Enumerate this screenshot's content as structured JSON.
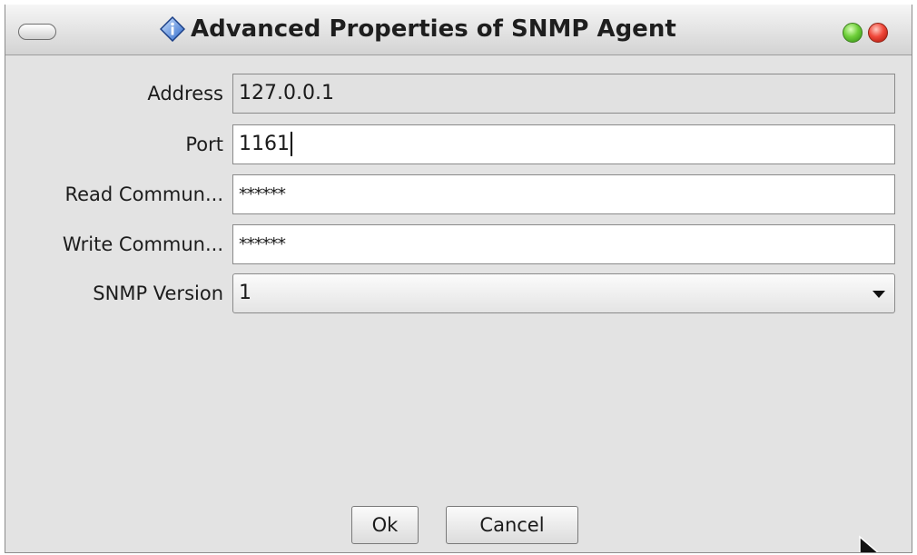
{
  "window": {
    "title": "Advanced Properties of SNMP Agent",
    "title_icon": "info-diamond-icon",
    "buttons": [
      "maximize-green-button",
      "close-red-button"
    ]
  },
  "form": {
    "address": {
      "label": "Address",
      "value": "127.0.0.1",
      "editable": false
    },
    "port": {
      "label": "Port",
      "value": "1161",
      "focused": true
    },
    "read_community": {
      "label": "Read Commun...",
      "value": "******"
    },
    "write_community": {
      "label": "Write Commun...",
      "value": "******"
    },
    "snmp_version": {
      "label": "SNMP Version",
      "value": "1"
    }
  },
  "buttons": {
    "ok": "Ok",
    "cancel": "Cancel"
  },
  "colors": {
    "window_bg": "#e3e3e3",
    "field_bg": "#ffffff",
    "readonly_bg": "#e1e1e1",
    "close": "#e53b2e",
    "maximize": "#5cbf2a"
  }
}
